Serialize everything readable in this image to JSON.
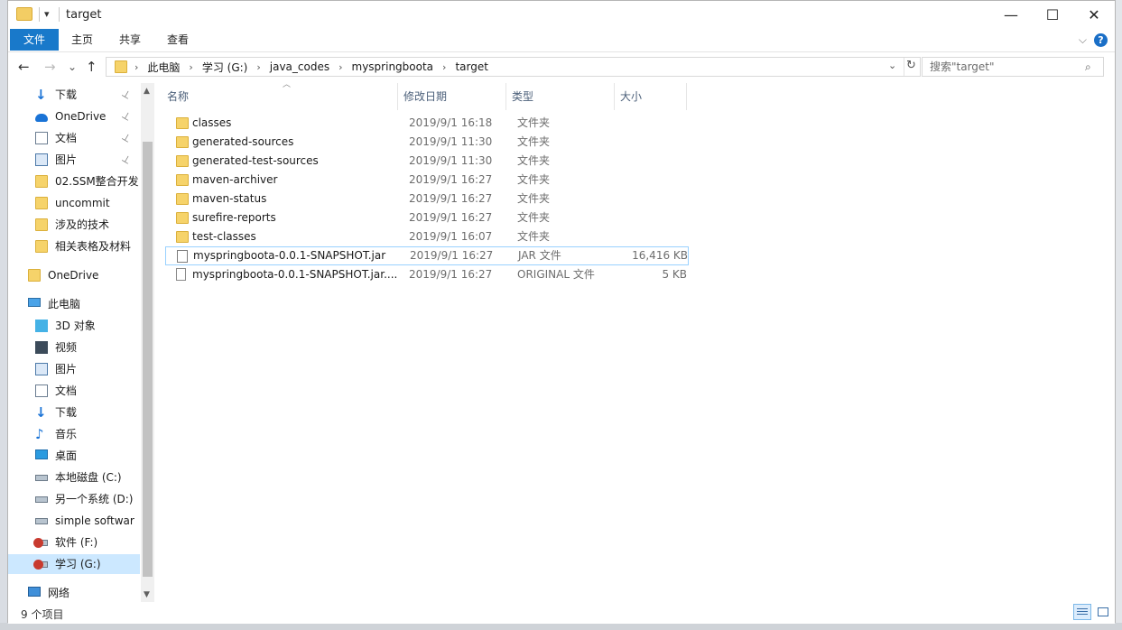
{
  "window": {
    "title": "target",
    "minimize": "—",
    "maximize": "☐",
    "close": "✕"
  },
  "ribbon": {
    "tabs": [
      "文件",
      "主页",
      "共享",
      "查看"
    ],
    "expand": "⌵",
    "help": "?"
  },
  "nav": {
    "back": "←",
    "forward": "→",
    "recent": "⌄",
    "up": "↑",
    "breadcrumb": [
      "此电脑",
      "学习 (G:)",
      "java_codes",
      "myspringboota",
      "target"
    ],
    "search_placeholder": "搜索\"target\"",
    "refresh": "↻"
  },
  "sidebar": {
    "items": [
      {
        "label": "下载",
        "icon": "download-icon",
        "pinned": true
      },
      {
        "label": "OneDrive",
        "icon": "cloud-icon",
        "pinned": true
      },
      {
        "label": "文档",
        "icon": "document-icon",
        "pinned": true
      },
      {
        "label": "图片",
        "icon": "picture-icon",
        "pinned": true
      },
      {
        "label": "02.SSM整合开发",
        "icon": "folder-icon",
        "pinned": false
      },
      {
        "label": "uncommit",
        "icon": "folder-icon",
        "pinned": false
      },
      {
        "label": "涉及的技术",
        "icon": "folder-icon",
        "pinned": false
      },
      {
        "label": "相关表格及材料",
        "icon": "folder-icon",
        "pinned": false
      },
      {
        "label": "OneDrive",
        "icon": "folder-icon",
        "pinned": false
      },
      {
        "label": "此电脑",
        "icon": "computer-icon",
        "pinned": false
      },
      {
        "label": "3D 对象",
        "icon": "cube-3d-icon",
        "pinned": false
      },
      {
        "label": "视频",
        "icon": "video-icon",
        "pinned": false
      },
      {
        "label": "图片",
        "icon": "picture-icon",
        "pinned": false
      },
      {
        "label": "文档",
        "icon": "document-icon",
        "pinned": false
      },
      {
        "label": "下载",
        "icon": "download-icon",
        "pinned": false
      },
      {
        "label": "音乐",
        "icon": "music-icon",
        "pinned": false
      },
      {
        "label": "桌面",
        "icon": "desktop-icon",
        "pinned": false
      },
      {
        "label": "本地磁盘 (C:)",
        "icon": "drive-icon",
        "pinned": false
      },
      {
        "label": "另一个系统 (D:)",
        "icon": "drive-icon",
        "pinned": false
      },
      {
        "label": "simple softwar",
        "icon": "drive-icon",
        "pinned": false
      },
      {
        "label": "软件 (F:)",
        "icon": "drive-warning-icon",
        "pinned": false
      },
      {
        "label": "学习 (G:)",
        "icon": "drive-warning-icon",
        "pinned": false,
        "selected": true
      },
      {
        "label": "网络",
        "icon": "network-icon",
        "pinned": false
      }
    ],
    "pin_glyph": "📌"
  },
  "columns": {
    "name": "名称",
    "date": "修改日期",
    "type": "类型",
    "size": "大小"
  },
  "files": [
    {
      "name": "classes",
      "date": "2019/9/1 16:18",
      "type": "文件夹",
      "size": "",
      "kind": "folder"
    },
    {
      "name": "generated-sources",
      "date": "2019/9/1 11:30",
      "type": "文件夹",
      "size": "",
      "kind": "folder"
    },
    {
      "name": "generated-test-sources",
      "date": "2019/9/1 11:30",
      "type": "文件夹",
      "size": "",
      "kind": "folder"
    },
    {
      "name": "maven-archiver",
      "date": "2019/9/1 16:27",
      "type": "文件夹",
      "size": "",
      "kind": "folder"
    },
    {
      "name": "maven-status",
      "date": "2019/9/1 16:27",
      "type": "文件夹",
      "size": "",
      "kind": "folder"
    },
    {
      "name": "surefire-reports",
      "date": "2019/9/1 16:27",
      "type": "文件夹",
      "size": "",
      "kind": "folder"
    },
    {
      "name": "test-classes",
      "date": "2019/9/1 16:07",
      "type": "文件夹",
      "size": "",
      "kind": "folder"
    },
    {
      "name": "myspringboota-0.0.1-SNAPSHOT.jar",
      "date": "2019/9/1 16:27",
      "type": "JAR 文件",
      "size": "16,416 KB",
      "kind": "jar",
      "selected": true
    },
    {
      "name": "myspringboota-0.0.1-SNAPSHOT.jar....",
      "date": "2019/9/1 16:27",
      "type": "ORIGINAL 文件",
      "size": "5 KB",
      "kind": "file"
    }
  ],
  "status": {
    "item_count": "9 个项目"
  }
}
